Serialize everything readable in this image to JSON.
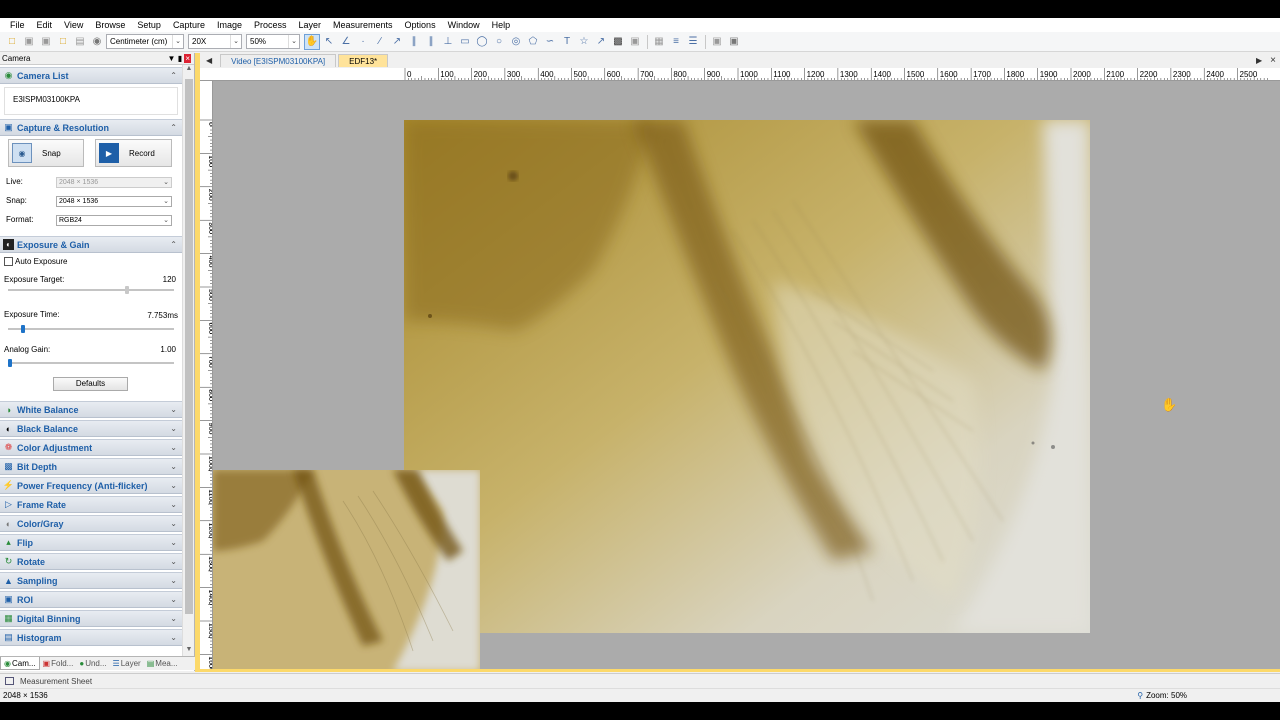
{
  "menu": [
    "File",
    "Edit",
    "View",
    "Browse",
    "Setup",
    "Capture",
    "Image",
    "Process",
    "Layer",
    "Measurements",
    "Options",
    "Window",
    "Help"
  ],
  "toolbar": {
    "unit": "Centimeter (cm)",
    "magnification": "20X",
    "zoom": "50%"
  },
  "panel": {
    "title": "Camera",
    "camera_list": {
      "label": "Camera List",
      "device": "E3ISPM03100KPA"
    },
    "capture": {
      "label": "Capture & Resolution",
      "snap_button": "Snap",
      "record_button": "Record",
      "live_label": "Live:",
      "live_value": "2048 × 1536",
      "snap_label": "Snap:",
      "snap_value": "2048 × 1536",
      "format_label": "Format:",
      "format_value": "RGB24"
    },
    "exposure": {
      "label": "Exposure & Gain",
      "auto_exposure": "Auto Exposure",
      "auto_exposure_checked": false,
      "target_label": "Exposure Target:",
      "target_value": "120",
      "target_level": 0.72,
      "time_label": "Exposure Time:",
      "time_value": "7.753ms",
      "time_level": 0.08,
      "gain_label": "Analog Gain:",
      "gain_value": "1.00",
      "gain_level": 0.0,
      "defaults_button": "Defaults"
    },
    "sections": [
      {
        "label": "White Balance",
        "icon": "white-balance-icon"
      },
      {
        "label": "Black Balance",
        "icon": "black-balance-icon"
      },
      {
        "label": "Color Adjustment",
        "icon": "color-wheel-icon"
      },
      {
        "label": "Bit Depth",
        "icon": "bit-depth-icon"
      },
      {
        "label": "Power Frequency (Anti-flicker)",
        "icon": "power-frequency-icon"
      },
      {
        "label": "Frame Rate",
        "icon": "frame-rate-icon"
      },
      {
        "label": "Color/Gray",
        "icon": "color-gray-icon"
      },
      {
        "label": "Flip",
        "icon": "flip-icon"
      },
      {
        "label": "Rotate",
        "icon": "rotate-icon"
      },
      {
        "label": "Sampling",
        "icon": "sampling-icon"
      },
      {
        "label": "ROI",
        "icon": "roi-icon"
      },
      {
        "label": "Digital Binning",
        "icon": "digital-binning-icon"
      },
      {
        "label": "Histogram",
        "icon": "histogram-icon"
      }
    ],
    "bottom_tabs": [
      "Cam...",
      "Fold...",
      "Und...",
      "Layer",
      "Mea..."
    ]
  },
  "doc_tabs": [
    "Video [E3ISPM03100KPA]",
    "EDF13*"
  ],
  "ruler_h": [
    "0",
    "100",
    "200",
    "300",
    "400",
    "500",
    "600",
    "700",
    "800",
    "900",
    "1000",
    "1100",
    "1200",
    "1300",
    "1400",
    "1500",
    "1600",
    "1700",
    "1800",
    "1900",
    "2000",
    "2100",
    "2200",
    "2300",
    "2400",
    "2500"
  ],
  "ruler_v": [
    "0",
    "100",
    "200",
    "300",
    "400",
    "500",
    "600",
    "700",
    "800",
    "900",
    "1000",
    "1100",
    "1200",
    "1300",
    "1400",
    "1500",
    "1600"
  ],
  "measurement_sheet": "Measurement Sheet",
  "status": {
    "resolution": "2048 × 1536",
    "zoom": "Zoom: 50%"
  }
}
